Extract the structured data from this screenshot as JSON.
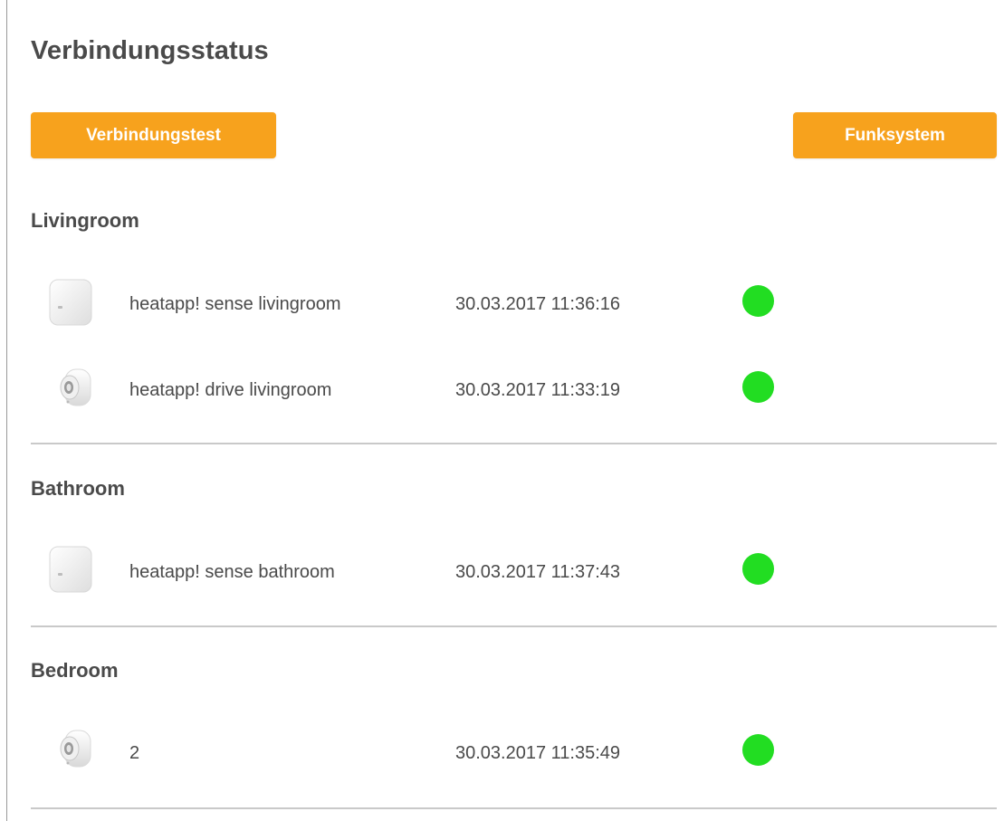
{
  "page": {
    "title": "Verbindungsstatus"
  },
  "toolbar": {
    "connection_test_label": "Verbindungstest",
    "radio_system_label": "Funksystem"
  },
  "colors": {
    "accent": "#f7a21d",
    "status_ok": "#22dd22"
  },
  "rooms": [
    {
      "name": "Livingroom",
      "devices": [
        {
          "type": "sense-icon",
          "name": "heatapp! sense livingroom",
          "last_seen": "30.03.2017 11:36:16",
          "status": "online"
        },
        {
          "type": "drive-icon",
          "name": "heatapp! drive livingroom",
          "last_seen": "30.03.2017 11:33:19",
          "status": "online"
        }
      ]
    },
    {
      "name": "Bathroom",
      "devices": [
        {
          "type": "sense-icon",
          "name": "heatapp! sense bathroom",
          "last_seen": "30.03.2017 11:37:43",
          "status": "online"
        }
      ]
    },
    {
      "name": "Bedroom",
      "devices": [
        {
          "type": "drive-icon",
          "name": "2",
          "last_seen": "30.03.2017 11:35:49",
          "status": "online"
        }
      ]
    }
  ]
}
